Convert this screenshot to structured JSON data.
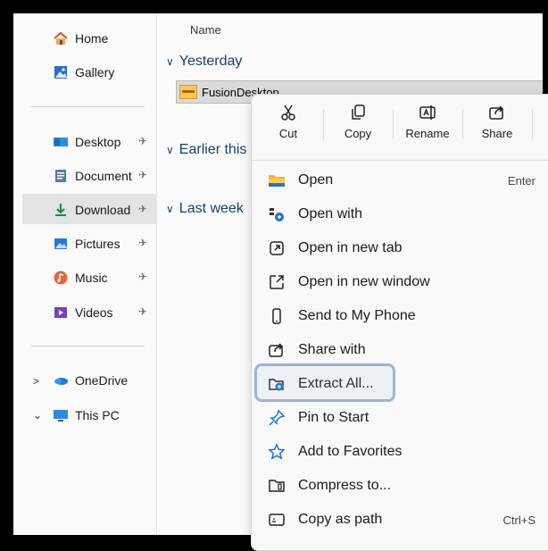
{
  "nav": {
    "items": [
      {
        "label": "Home",
        "icon": "home-icon"
      },
      {
        "label": "Gallery",
        "icon": "gallery-icon"
      },
      {
        "label": "Desktop",
        "icon": "desktop-icon"
      },
      {
        "label": "Document",
        "icon": "documents-icon"
      },
      {
        "label": "Download",
        "icon": "download-icon"
      },
      {
        "label": "Pictures",
        "icon": "pictures-icon"
      },
      {
        "label": "Music",
        "icon": "music-icon"
      },
      {
        "label": "Videos",
        "icon": "videos-icon"
      },
      {
        "label": "OneDrive",
        "icon": "onedrive-icon"
      },
      {
        "label": "This PC",
        "icon": "this-pc-icon"
      }
    ]
  },
  "main": {
    "column_header": "Name",
    "groups": [
      "Yesterday",
      "Earlier this",
      "Last week"
    ],
    "file": "FusionDesktop"
  },
  "context_menu": {
    "toolbar": [
      "Cut",
      "Copy",
      "Rename",
      "Share"
    ],
    "items": [
      {
        "label": "Open",
        "shortcut": "Enter"
      },
      {
        "label": "Open with",
        "shortcut": ""
      },
      {
        "label": "Open in new tab",
        "shortcut": ""
      },
      {
        "label": "Open in new window",
        "shortcut": ""
      },
      {
        "label": "Send to My Phone",
        "shortcut": ""
      },
      {
        "label": "Share with",
        "shortcut": ""
      },
      {
        "label": "Extract All...",
        "shortcut": ""
      },
      {
        "label": "Pin to Start",
        "shortcut": ""
      },
      {
        "label": "Add to Favorites",
        "shortcut": ""
      },
      {
        "label": "Compress to...",
        "shortcut": ""
      },
      {
        "label": "Copy as path",
        "shortcut": "Ctrl+S"
      }
    ]
  },
  "colors": {
    "accent": "#0067c0",
    "highlight_border": "#9db3d8"
  }
}
